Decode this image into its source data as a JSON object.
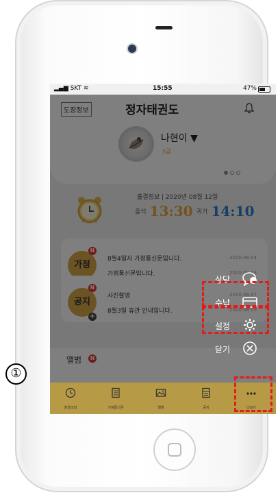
{
  "status_bar": {
    "carrier": "SKT",
    "time": "15:55",
    "battery": "47%"
  },
  "header": {
    "dojang_button": "도장정보",
    "title": "정자태권도",
    "member_name": "나현이 ▼",
    "member_level": "3급"
  },
  "attendance": {
    "info": "출결정보 | 2020년 08월 12일",
    "in_label": "출석",
    "in_time": "13:30",
    "out_label": "귀가",
    "out_time": "14:10"
  },
  "home_card": {
    "label": "가정",
    "badge": "N",
    "items": [
      {
        "text": "8월4일자 가정통신문입니다.",
        "date": "2020.08.04"
      },
      {
        "text": "가정통신문입니다.",
        "date": "2020.08.03"
      }
    ]
  },
  "notice_card": {
    "label": "공지",
    "badge": "N",
    "items": [
      {
        "text": "사진촬영",
        "date": "2020.08.07"
      },
      {
        "text": "8월3일 휴관 안내입니다.",
        "date": "2020.08.03"
      }
    ]
  },
  "album": {
    "label": "앨범",
    "badge": "N"
  },
  "more_menu": {
    "items": [
      {
        "label": "상담",
        "icon": "chat-icon"
      },
      {
        "label": "수납",
        "icon": "card-icon"
      },
      {
        "label": "설정",
        "icon": "gear-icon"
      },
      {
        "label": "닫기",
        "icon": "close-icon"
      }
    ]
  },
  "tabs": [
    {
      "label": "출결조회",
      "icon": "clock-icon"
    },
    {
      "label": "가정통신문",
      "icon": "document-icon"
    },
    {
      "label": "앨범",
      "icon": "image-icon"
    },
    {
      "label": "공지",
      "icon": "notice-icon"
    },
    {
      "label": "더보기",
      "icon": "more-icon"
    }
  ],
  "step_marker": "①",
  "colors": {
    "tabbar": "#b79a45",
    "accent_gold": "#d9a746",
    "in_time": "#e8a23a",
    "out_time": "#2c7cd1",
    "highlight": "#e41b17"
  }
}
